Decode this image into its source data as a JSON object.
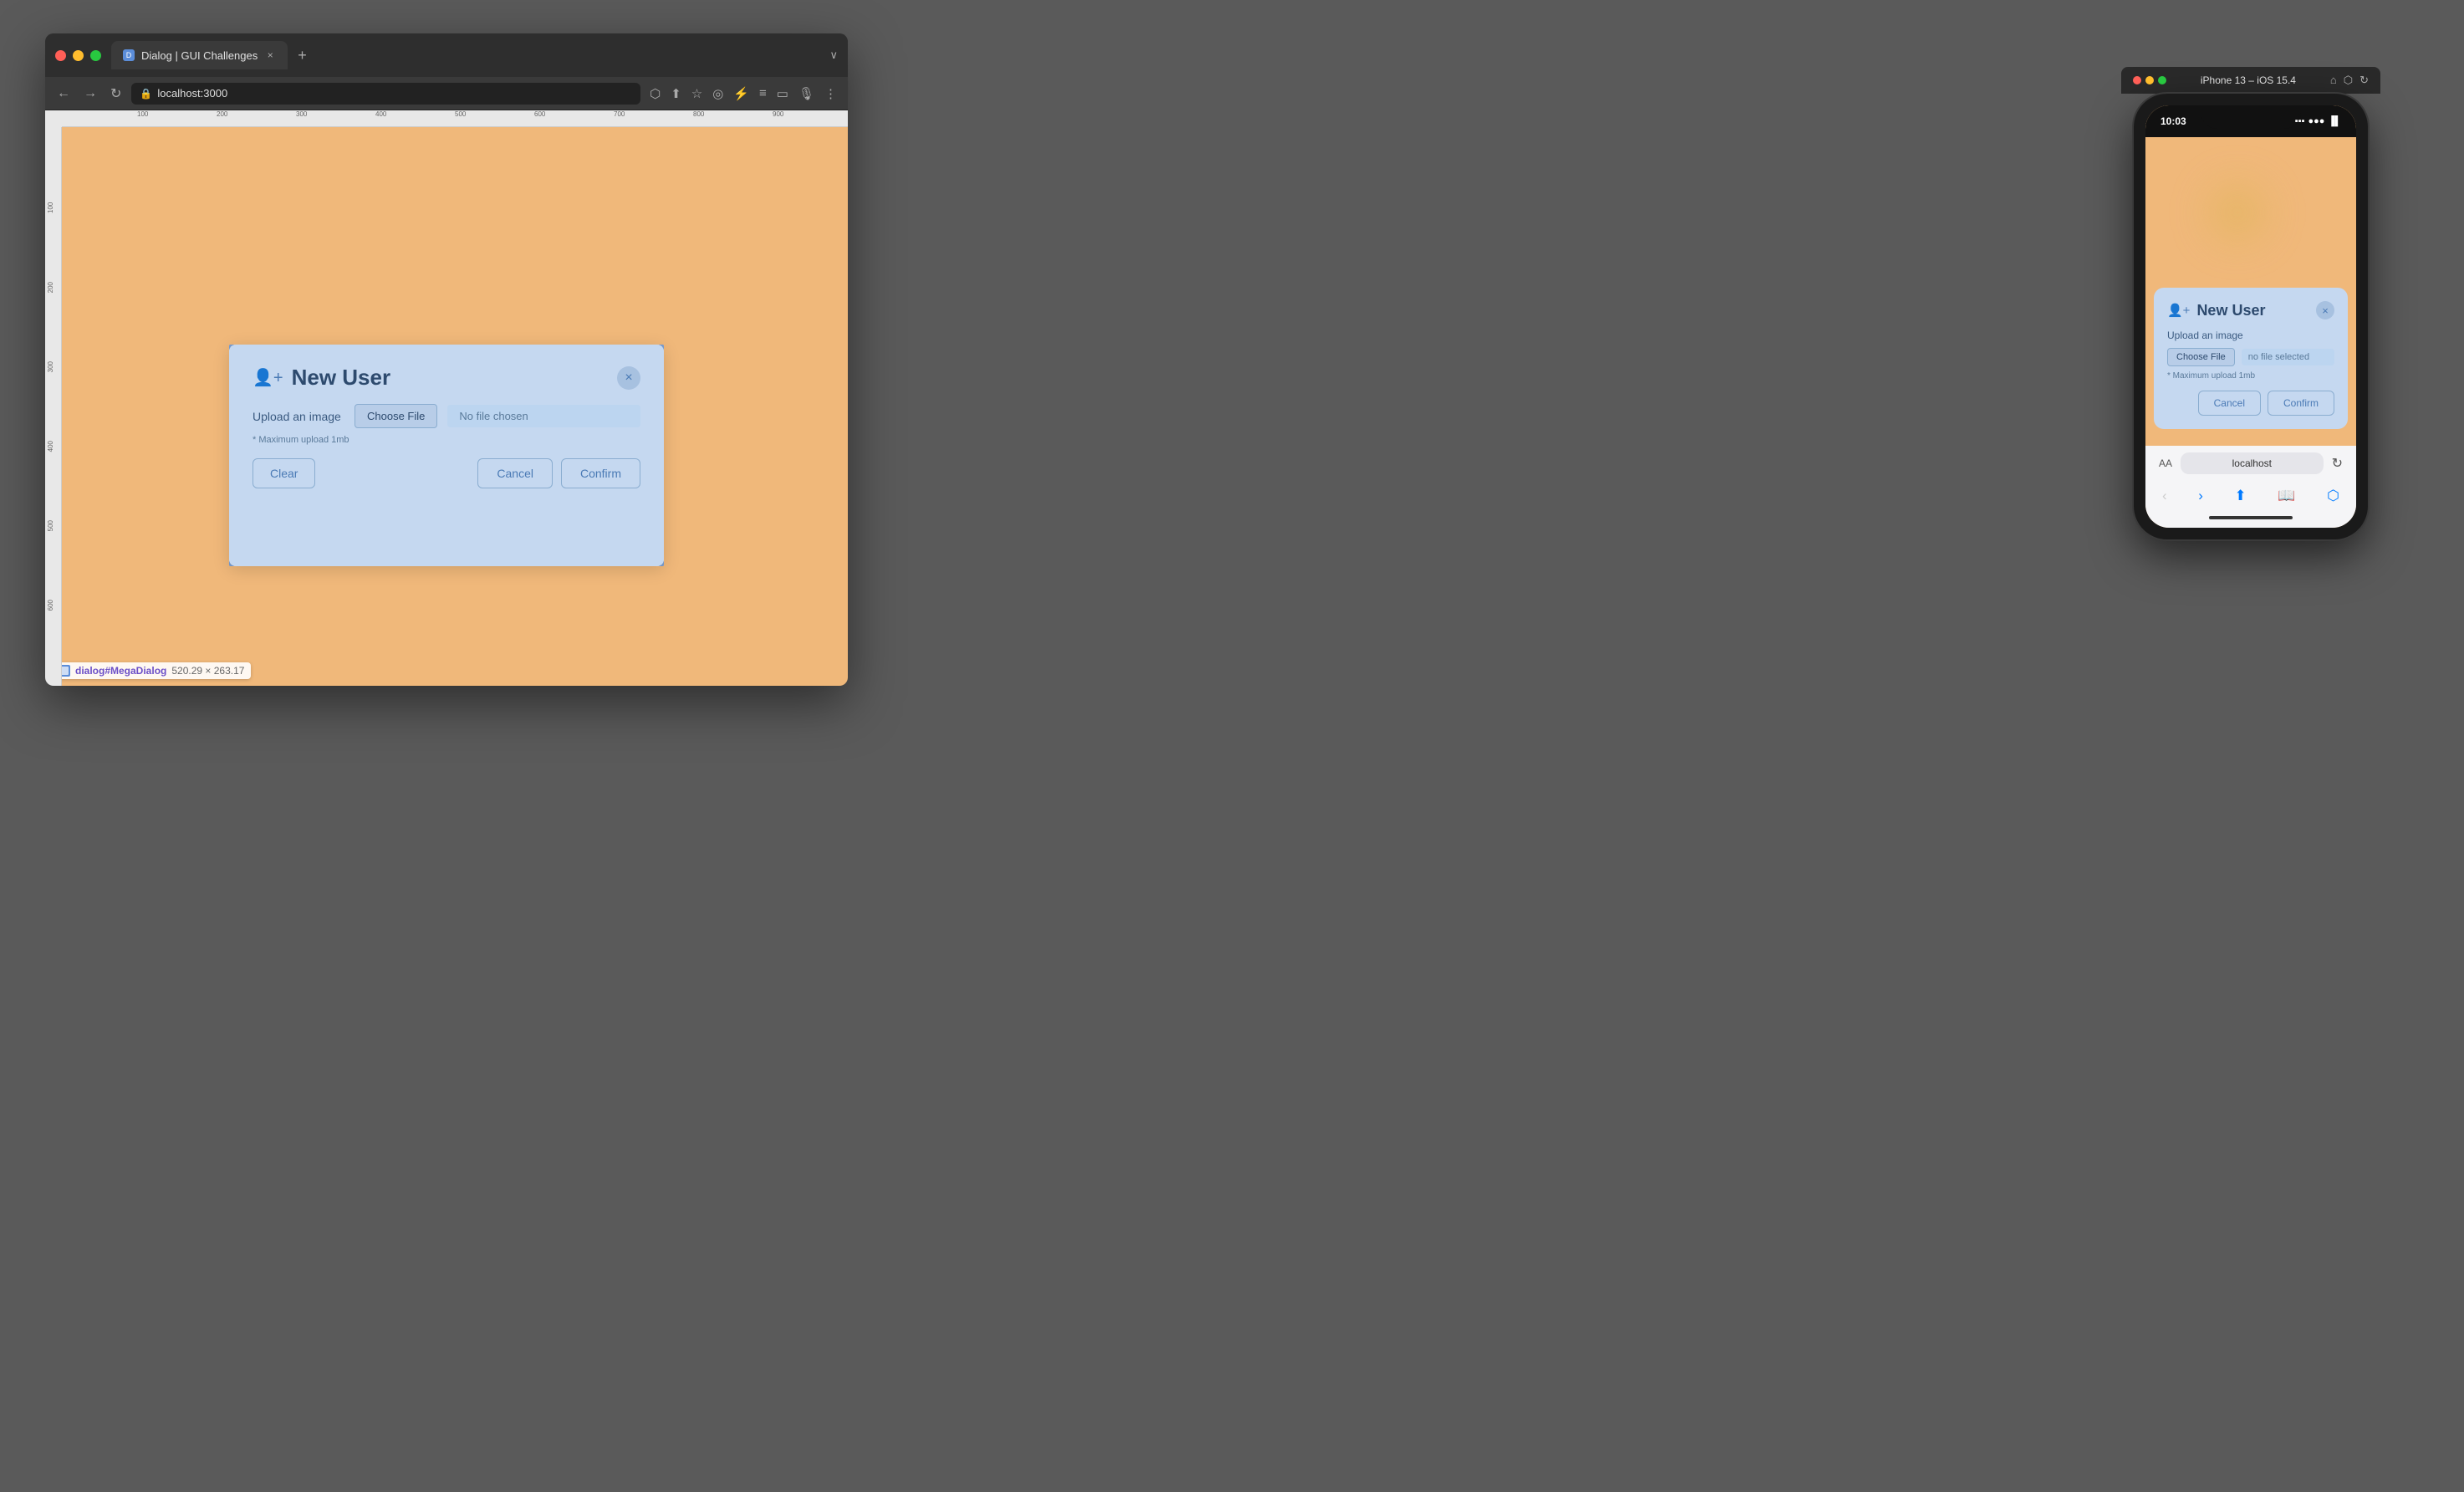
{
  "browser": {
    "tab_title": "Dialog | GUI Challenges",
    "tab_favicon": "D",
    "address": "localhost:3000",
    "tab_close": "×",
    "tab_new": "+",
    "nav_back": "←",
    "nav_fwd": "→",
    "nav_reload": "↻",
    "toolbar_expand": "∨"
  },
  "dialog": {
    "title": "New User",
    "icon": "👤",
    "close_btn": "×",
    "upload_label": "Upload an image",
    "choose_file_btn": "Choose File",
    "no_file_text": "No file chosen",
    "hint": "* Maximum upload 1mb",
    "btn_clear": "Clear",
    "btn_cancel": "Cancel",
    "btn_confirm": "Confirm"
  },
  "element_label": {
    "id": "dialog#MegaDialog",
    "dims": "520.29 × 263.17"
  },
  "iphone": {
    "window_title": "iPhone 13 – iOS 15.4",
    "time": "10:03",
    "dialog_title": "New User",
    "dialog_icon": "👤",
    "close_btn": "×",
    "upload_label": "Upload an image",
    "choose_file_btn": "Choose File",
    "no_file_text": "no file selected",
    "hint": "* Maximum upload 1mb",
    "btn_cancel": "Cancel",
    "btn_confirm": "Confirm",
    "url": "localhost",
    "url_prefix": "AA"
  },
  "ruler": {
    "h_ticks": [
      "100",
      "200",
      "300",
      "400",
      "500",
      "600",
      "700",
      "800",
      "900"
    ],
    "v_ticks": [
      "100",
      "200",
      "300",
      "400",
      "500",
      "600"
    ]
  }
}
